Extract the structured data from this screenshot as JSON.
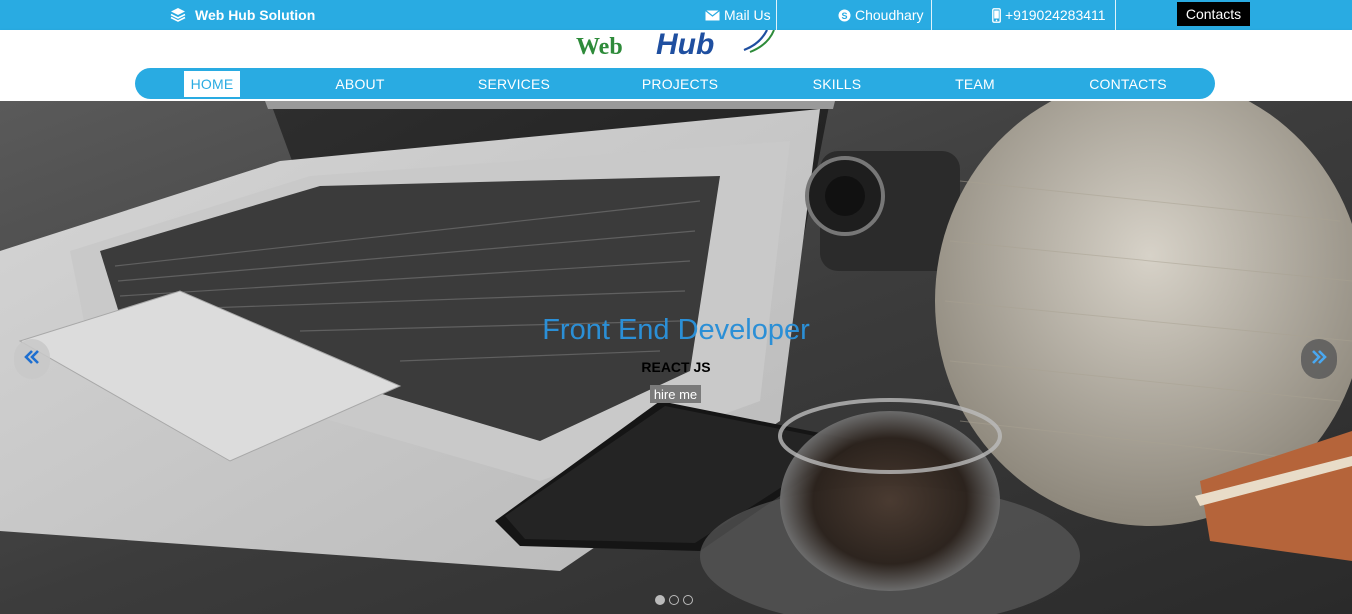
{
  "topbar": {
    "brand": "Web Hub Solution",
    "mail_label": "Mail Us",
    "skype_label": "Choudhary",
    "phone_label": "+919024283411",
    "contacts_button": "Contacts"
  },
  "logo": {
    "text_web": "Web",
    "text_hub": "Hub"
  },
  "nav": {
    "items": [
      {
        "label": "HOME",
        "active": true
      },
      {
        "label": "ABOUT"
      },
      {
        "label": "SERVICES"
      },
      {
        "label": "PROJECTS"
      },
      {
        "label": "SKILLS"
      },
      {
        "label": "TEAM"
      },
      {
        "label": "CONTACTS"
      }
    ]
  },
  "hero": {
    "title": "Front End Developer",
    "subtitle": "REACT JS",
    "button": "hire me",
    "slide_count": 3,
    "active_slide": 1
  },
  "colors": {
    "accent": "#29abe2",
    "caption_title": "#2b8fd6",
    "logo_web": "#2e8b3a",
    "logo_hub": "#1f4fa0"
  },
  "icons": {
    "brand": "layers-icon",
    "mail": "envelope-icon",
    "skype": "skype-icon",
    "phone": "mobile-phone-icon",
    "prev": "double-chevron-left-icon",
    "next": "double-chevron-right-icon"
  }
}
